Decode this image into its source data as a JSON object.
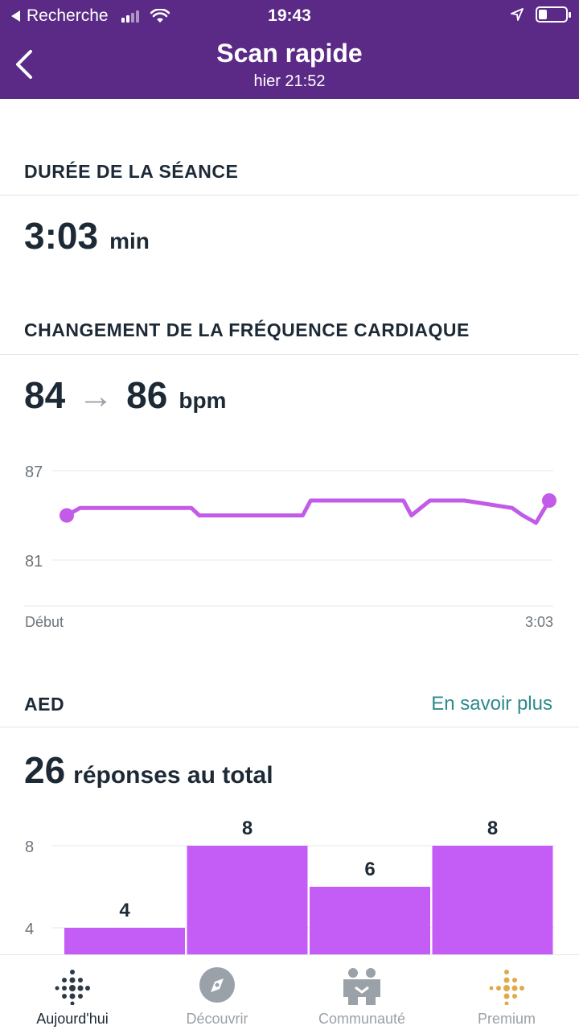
{
  "status_bar": {
    "back_label": "Recherche",
    "time": "19:43"
  },
  "header": {
    "title": "Scan rapide",
    "subtitle": "hier 21:52"
  },
  "duration": {
    "label": "DURÉE DE LA SÉANCE",
    "value": "3:03",
    "unit": "min"
  },
  "heart_rate": {
    "label": "CHANGEMENT DE LA FRÉQUENCE CARDIAQUE",
    "start": "84",
    "end": "86",
    "unit": "bpm",
    "arrow": "→"
  },
  "aed": {
    "label": "AED",
    "link": "En savoir plus",
    "total_value": "26",
    "total_label": "réponses au total"
  },
  "chart_data": [
    {
      "type": "line",
      "ytick_labels": [
        "87",
        "81"
      ],
      "xtick_labels": [
        "Début",
        "3:03"
      ],
      "ylim": [
        80.5,
        87.5
      ],
      "color": "#c25be8",
      "series": [
        {
          "x": [
            0,
            5,
            10,
            47,
            50,
            89,
            92,
            127,
            130,
            137,
            150,
            168,
            172,
            177,
            182
          ],
          "y": [
            84.0,
            84.5,
            84.5,
            84.5,
            84.0,
            84.0,
            85.0,
            85.0,
            84.0,
            85.0,
            85.0,
            84.5,
            84.0,
            83.5,
            85.0
          ]
        }
      ]
    },
    {
      "type": "bar",
      "categories": [
        "",
        "",
        "",
        ""
      ],
      "values": [
        4,
        8,
        6,
        8
      ],
      "ytick_labels": [
        "8",
        "4"
      ],
      "color": "#c45df5"
    }
  ],
  "tabs": [
    {
      "label": "Aujourd'hui"
    },
    {
      "label": "Découvrir"
    },
    {
      "label": "Communauté"
    },
    {
      "label": "Premium"
    }
  ]
}
